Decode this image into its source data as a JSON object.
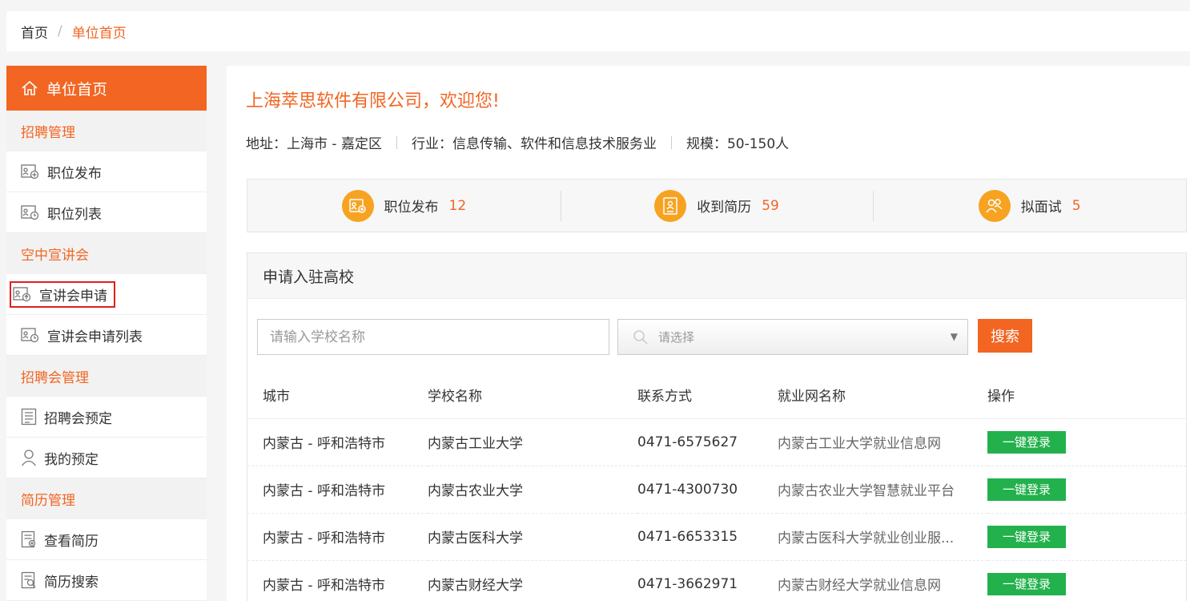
{
  "breadcrumb": {
    "home": "首页",
    "separator": "/",
    "current": "单位首页"
  },
  "sidebar": {
    "home_label": "单位首页",
    "groups": [
      {
        "title": "招聘管理",
        "items": [
          {
            "label": "职位发布"
          },
          {
            "label": "职位列表"
          }
        ]
      },
      {
        "title": "空中宣讲会",
        "items": [
          {
            "label": "宣讲会申请"
          },
          {
            "label": "宣讲会申请列表"
          }
        ]
      },
      {
        "title": "招聘会管理",
        "items": [
          {
            "label": "招聘会预定"
          },
          {
            "label": "我的预定"
          }
        ]
      },
      {
        "title": "简历管理",
        "items": [
          {
            "label": "查看简历"
          },
          {
            "label": "简历搜索"
          }
        ]
      }
    ]
  },
  "company": {
    "welcome": "上海萃思软件有限公司，欢迎您!",
    "address": "地址：上海市 - 嘉定区",
    "industry": "行业：信息传输、软件和信息技术服务业",
    "scale": "规模：50-150人"
  },
  "stats": [
    {
      "label": "职位发布",
      "value": "12"
    },
    {
      "label": "收到简历",
      "value": "59"
    },
    {
      "label": "拟面试",
      "value": "5"
    }
  ],
  "panel": {
    "title": "申请入驻高校",
    "school_placeholder": "请输入学校名称",
    "select_placeholder": "请选择",
    "search_label": "搜索",
    "columns": [
      "城市",
      "学校名称",
      "联系方式",
      "就业网名称",
      "操作"
    ],
    "login_label": "一键登录",
    "rows": [
      {
        "city": "内蒙古 - 呼和浩特市",
        "school": "内蒙古工业大学",
        "phone": "0471-6575627",
        "site": "内蒙古工业大学就业信息网"
      },
      {
        "city": "内蒙古 - 呼和浩特市",
        "school": "内蒙古农业大学",
        "phone": "0471-4300730",
        "site": "内蒙古农业大学智慧就业平台"
      },
      {
        "city": "内蒙古 - 呼和浩特市",
        "school": "内蒙古医科大学",
        "phone": "0471-6653315",
        "site": "内蒙古医科大学就业创业服..."
      },
      {
        "city": "内蒙古 - 呼和浩特市",
        "school": "内蒙古财经大学",
        "phone": "0471-3662971",
        "site": "内蒙古财经大学就业信息网"
      }
    ]
  },
  "colors": {
    "accent": "#f26522",
    "stat_icon": "#f7a321",
    "login_button": "#22b14c",
    "highlight_border": "#e02020"
  }
}
